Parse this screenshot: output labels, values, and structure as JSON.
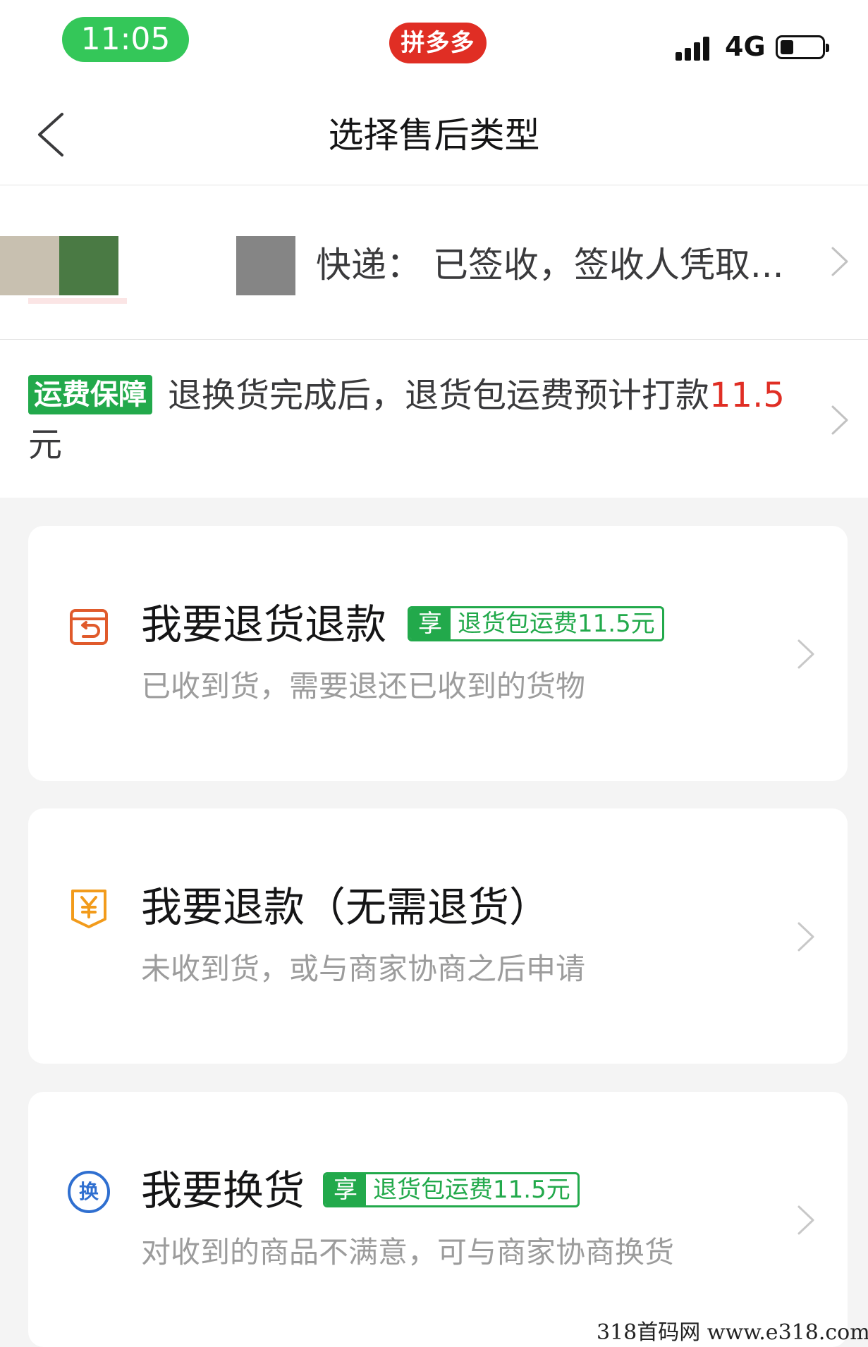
{
  "status_bar": {
    "time": "11:05",
    "app_name": "拼多多",
    "network": "4G"
  },
  "nav": {
    "title": "选择售后类型"
  },
  "order": {
    "delivery_status": "快递：  已签收，签收人凭取..."
  },
  "shipping_guarantee": {
    "badge": "运费保障",
    "text": "退换货完成后，退货包运费预计打款",
    "amount": "11.5",
    "unit": "元"
  },
  "options": [
    {
      "icon": "return-box-icon",
      "title": "我要退货退款",
      "tag_key": "享",
      "tag_value": "退货包运费11.5元",
      "description": "已收到货，需要退还已收到的货物"
    },
    {
      "icon": "yuan-refund-icon",
      "title": "我要退款（无需退货）",
      "description": "未收到货，或与商家协商之后申请"
    },
    {
      "icon": "exchange-icon",
      "icon_glyph": "换",
      "title": "我要换货",
      "tag_key": "享",
      "tag_value": "退货包运费11.5元",
      "description": "对收到的商品不满意，可与商家协商换货"
    }
  ],
  "watermark": "318首码网  www.e318.com",
  "colors": {
    "brand_red": "#e02e24",
    "green": "#22a94b",
    "status_green": "#34c759",
    "orange_icon": "#e05a2b",
    "amber_icon": "#f29b1b",
    "blue_icon": "#2f6fd0"
  }
}
